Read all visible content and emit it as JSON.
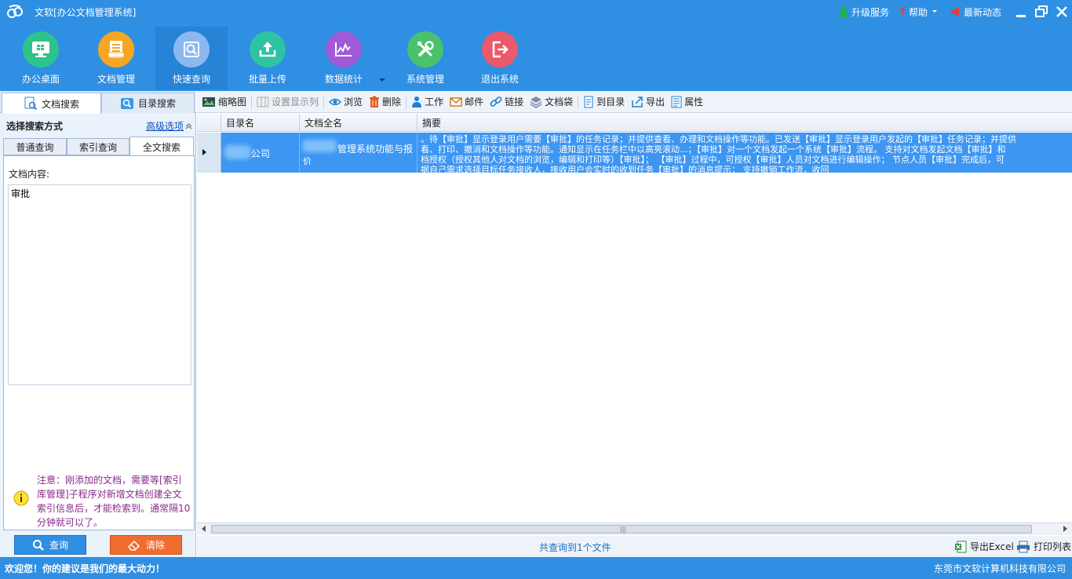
{
  "titlebar": {
    "app_title": "文软[办公文档管理系统]",
    "logo_icon": "wenruan-logo-icon",
    "links": [
      {
        "label": "升级服务",
        "icon": "user-upgrade-icon"
      },
      {
        "label": "帮助",
        "icon": "help-icon"
      },
      {
        "label": "最新动态",
        "icon": "megaphone-icon"
      }
    ]
  },
  "main_toolbar": {
    "buttons": [
      {
        "label": "办公桌面",
        "icon": "desktop-icon",
        "color": "#2ec38b"
      },
      {
        "label": "文档管理",
        "icon": "document-icon",
        "color": "#f5a623"
      },
      {
        "label": "快速查询",
        "icon": "search-icon",
        "color": "#8cb8f0",
        "active": true
      },
      {
        "label": "批量上传",
        "icon": "upload-icon",
        "color": "#2ec3a3"
      },
      {
        "label": "数据统计",
        "icon": "chart-icon",
        "color": "#a05ad8"
      },
      {
        "label": "系统管理",
        "icon": "tools-icon",
        "color": "#49c26b"
      },
      {
        "label": "退出系统",
        "icon": "exit-icon",
        "color": "#ea5a6a"
      }
    ]
  },
  "left_panel": {
    "tabs": [
      {
        "label": "文档搜索",
        "icon": "doc-search-icon",
        "active": true
      },
      {
        "label": "目录搜索",
        "icon": "folder-search-icon",
        "active": false
      }
    ],
    "section_title": "选择搜索方式",
    "advanced_link": "高级选项",
    "search_tabs": [
      {
        "label": "普通查询",
        "active": false
      },
      {
        "label": "索引查询",
        "active": false
      },
      {
        "label": "全文搜索",
        "active": true
      }
    ],
    "content_label": "文档内容:",
    "content_value": "审批",
    "notice": "注意：刚添加的文档，需要等[索引库管理]子程序对新增文档创建全文索引信息后，才能检索到。通常隔10分钟就可以了。",
    "query_button": "查询",
    "clear_button": "清除"
  },
  "secondary_toolbar": {
    "items": [
      {
        "label": "缩略图",
        "icon": "thumbnail-icon",
        "disabled": false
      },
      {
        "label": "设置显示列",
        "icon": "columns-icon",
        "disabled": true
      },
      {
        "label": "浏览",
        "icon": "eye-icon",
        "disabled": false
      },
      {
        "label": "删除",
        "icon": "trash-icon",
        "disabled": false
      },
      {
        "label": "工作",
        "icon": "person-icon",
        "disabled": false
      },
      {
        "label": "邮件",
        "icon": "mail-icon",
        "disabled": false
      },
      {
        "label": "链接",
        "icon": "link-icon",
        "disabled": false
      },
      {
        "label": "文档袋",
        "icon": "layers-icon",
        "disabled": false
      },
      {
        "label": "到目录",
        "icon": "goto-folder-icon",
        "disabled": false
      },
      {
        "label": "导出",
        "icon": "export-icon",
        "disabled": false
      },
      {
        "label": "属性",
        "icon": "properties-icon",
        "disabled": false
      }
    ]
  },
  "grid": {
    "columns": [
      "目录名",
      "文档全名",
      "摘要"
    ],
    "rows": [
      {
        "dir_suffix": "公司",
        "name_suffix": "管理系统功能与报",
        "name_line2": "价",
        "summary_lines": [
          "。待【审批】显示登录用户需要【审批】的任务记录；并提供查看、办理和文档操作等功能。已发送【审批】显示登录用户发起的【审批】任务记录；并提供",
          "看、打印、撤消和文档操作等功能。通知显示在任务栏中以高亮滚动...；【审批】对一个文档发起一个系统【审批】流程。  支持对文档发起文档【审批】和",
          "档授权（授权其他人对文档的浏览，编辑和打印等）【审批】；  【审批】过程中，可授权【审批】人员对文档进行编辑操作；  节点人员【审批】完成后，可",
          "据自己需求选择目标任务接收人，接收用户会实时的收到任务【审批】的消息提示；  支持撤销工作流，收回"
        ]
      }
    ]
  },
  "grid_status": {
    "count_text": "共查询到1个文件",
    "export_excel": "导出Excel",
    "print_list": "打印列表"
  },
  "footer": {
    "left_text": "欢迎您！你的建议是我们的最大动力！",
    "right_text": "东莞市文软计算机科技有限公司"
  }
}
